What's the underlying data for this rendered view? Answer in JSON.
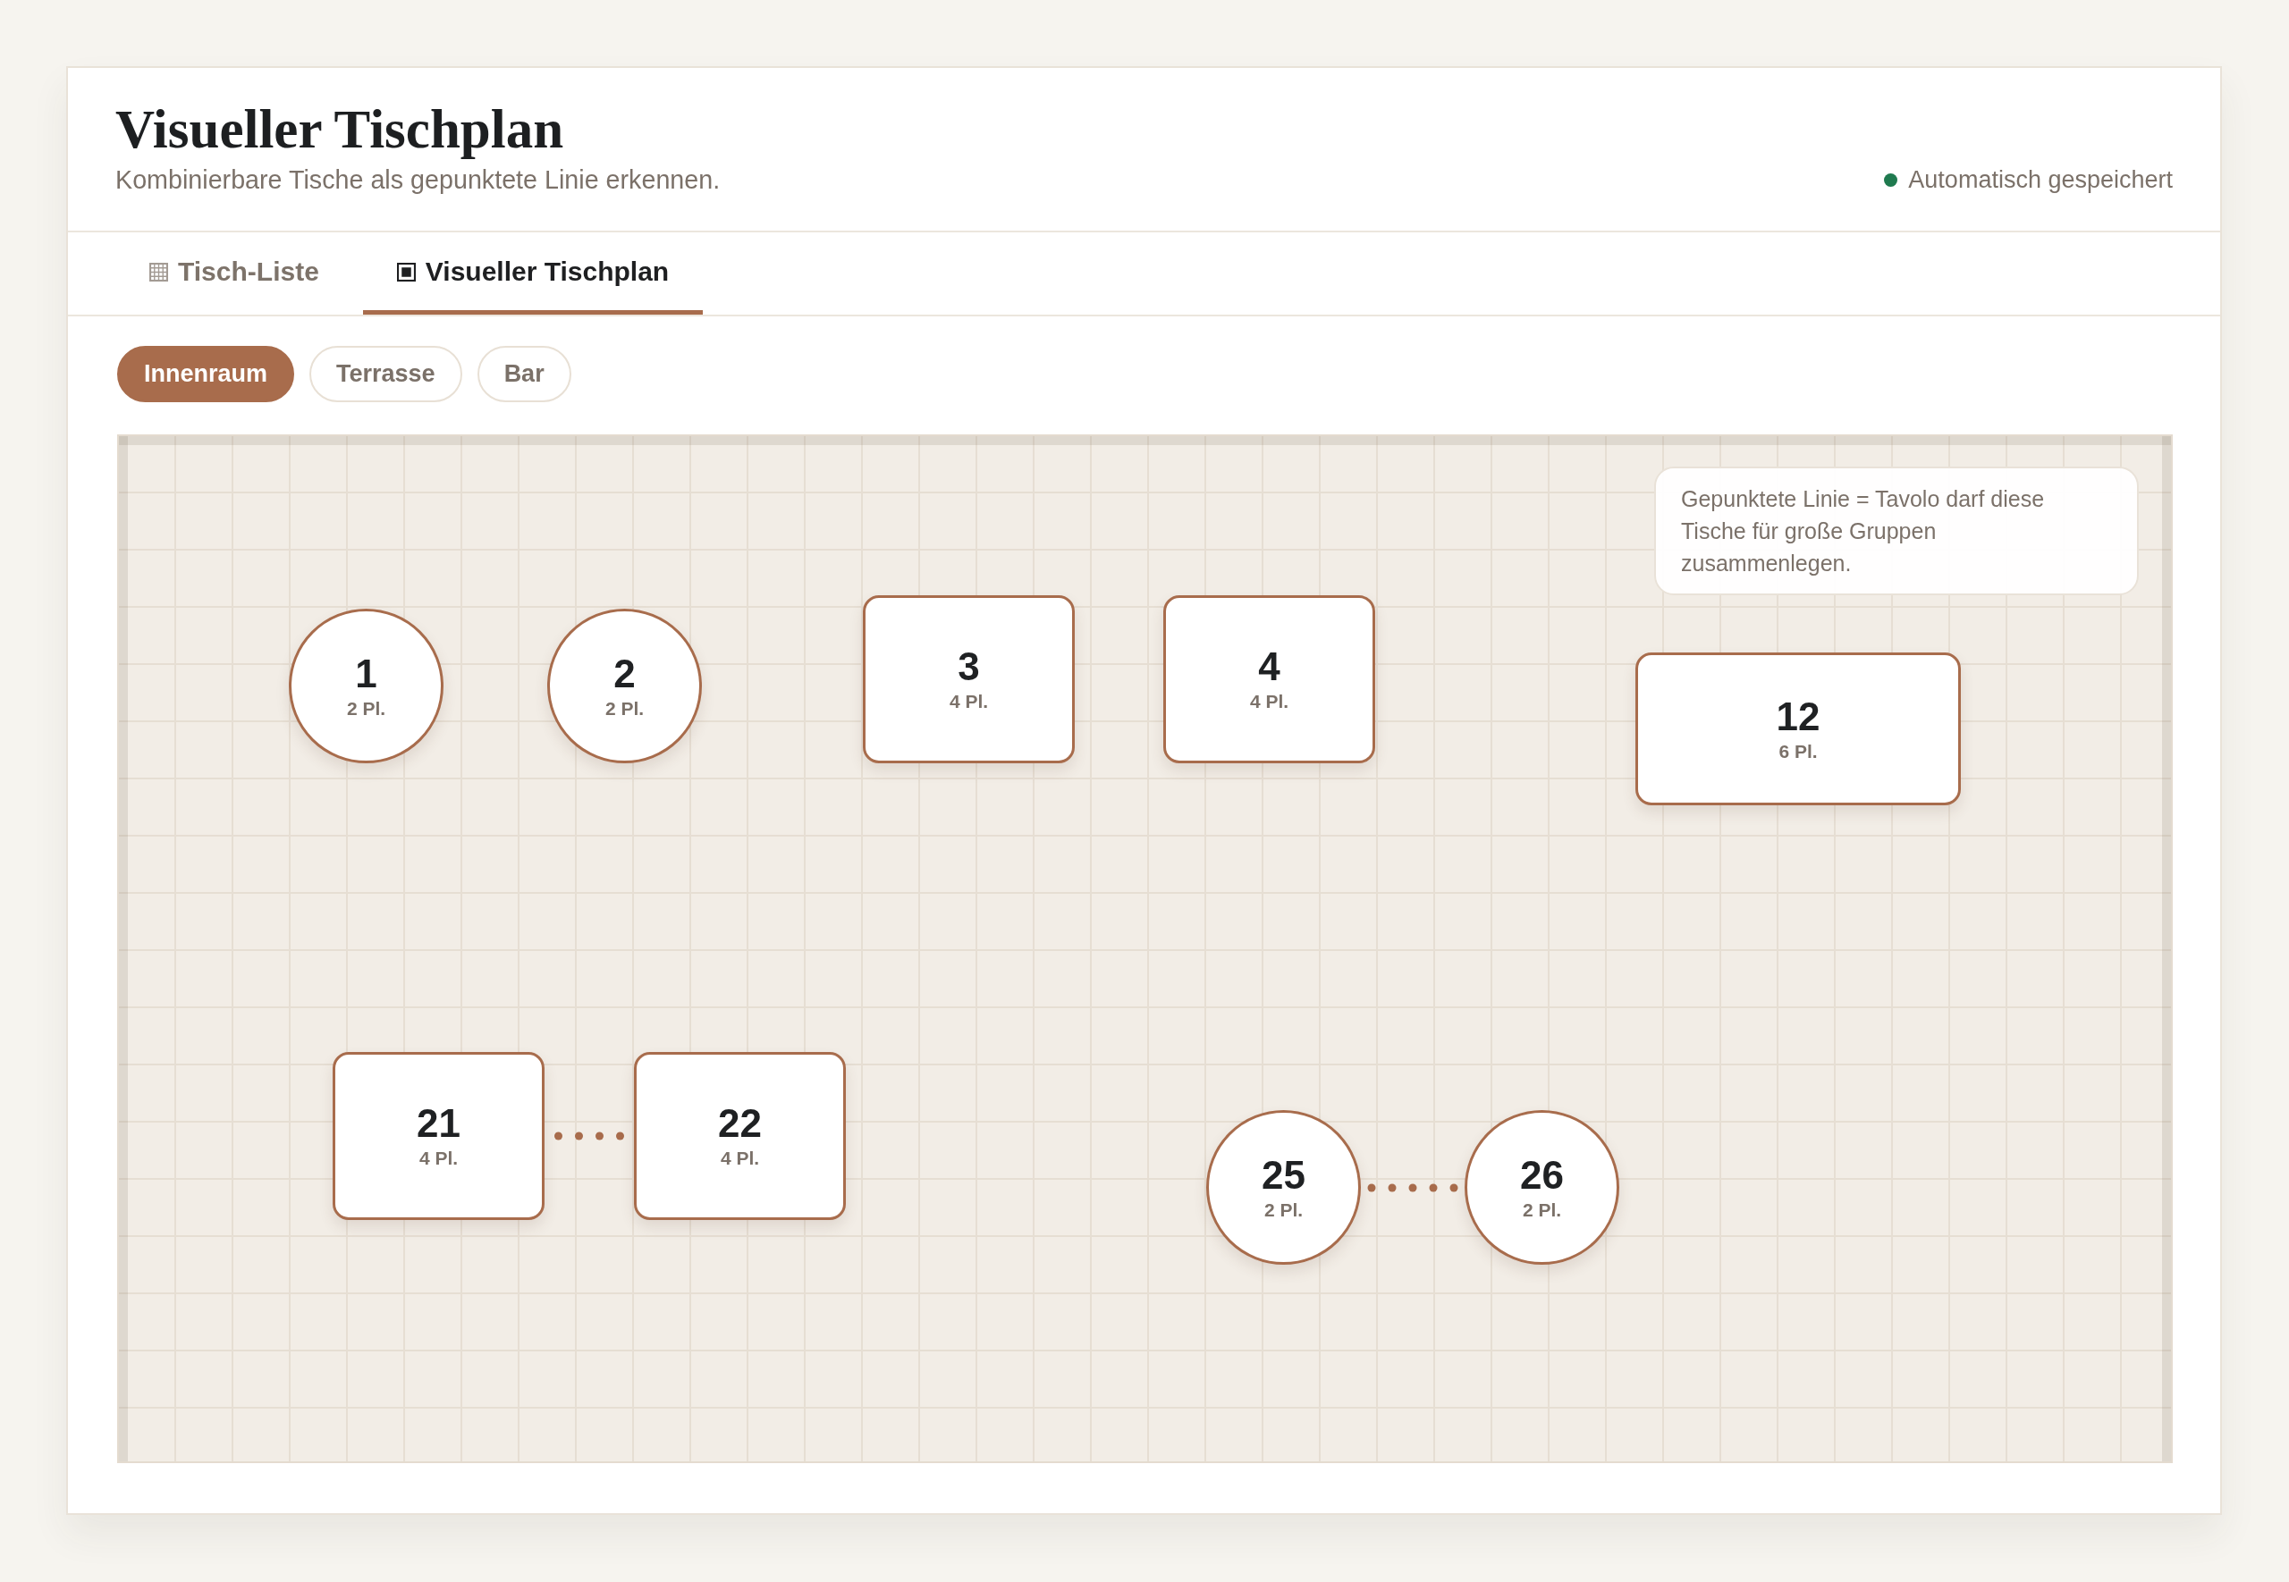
{
  "header": {
    "title": "Visueller Tischplan",
    "subtitle": "Kombinierbare Tische als gepunktete Linie erkennen.",
    "status": "Automatisch gespeichert"
  },
  "tabs": [
    {
      "label": "Tisch-Liste",
      "kind": "list",
      "selected": false
    },
    {
      "label": "Visueller Tischplan",
      "kind": "plan",
      "selected": true
    }
  ],
  "areas": [
    {
      "label": "Innenraum",
      "selected": true
    },
    {
      "label": "Terrasse",
      "selected": false
    },
    {
      "label": "Bar",
      "selected": false
    }
  ],
  "floor_plan": {
    "legend": "Gepunktete Linie = Tavolo darf diese Tische für große Gruppen zusammenlegen.",
    "tables": [
      {
        "number": "1",
        "seats": "2 Pl.",
        "kind": "round"
      },
      {
        "number": "2",
        "seats": "2 Pl.",
        "kind": "round"
      },
      {
        "number": "3",
        "seats": "4 Pl.",
        "kind": "rect"
      },
      {
        "number": "4",
        "seats": "4 Pl.",
        "kind": "rect"
      },
      {
        "number": "12",
        "seats": "6 Pl.",
        "kind": "long"
      },
      {
        "kind": "combination",
        "tables": [
          {
            "number": "21",
            "seats": "4 Pl.",
            "kind": "rect"
          },
          {
            "number": "22",
            "seats": "4 Pl.",
            "kind": "rect"
          }
        ]
      },
      {
        "kind": "combination",
        "tables": [
          {
            "number": "25",
            "seats": "2 Pl.",
            "kind": "round"
          },
          {
            "number": "26",
            "seats": "2 Pl.",
            "kind": "round"
          }
        ]
      }
    ]
  }
}
